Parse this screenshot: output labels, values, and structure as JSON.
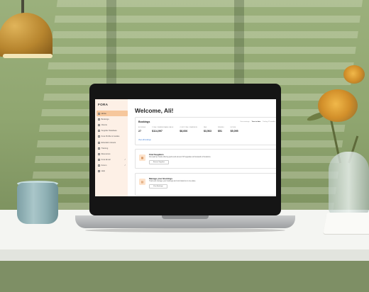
{
  "app": {
    "logo": "FORA"
  },
  "sidebar": {
    "items": [
      {
        "label": "Home",
        "icon": "home-icon",
        "active": true
      },
      {
        "label": "Bookings",
        "icon": "calendar-icon"
      },
      {
        "label": "Clients",
        "icon": "users-icon"
      },
      {
        "label": "Supplier Database",
        "icon": "database-icon"
      },
      {
        "label": "Fora Profile & Guides",
        "icon": "profile-icon"
      },
      {
        "label": "Education Assets",
        "icon": "book-icon"
      },
      {
        "label": "Training",
        "icon": "training-icon"
      },
      {
        "label": "Resources",
        "icon": "resources-icon"
      },
      {
        "label": "Fora Email",
        "icon": "mail-icon",
        "external": true
      },
      {
        "label": "Forum",
        "icon": "forum-icon",
        "external": true
      },
      {
        "label": "Help",
        "icon": "help-icon"
      }
    ],
    "external_glyph": "↗"
  },
  "main": {
    "welcome": "Welcome, Ali!",
    "bookings": {
      "title": "Bookings",
      "periods": [
        "Year to date",
        "Trailing 12 months"
      ],
      "period_prefix": "Your earnings",
      "stats": [
        {
          "label": "BOOKINGS",
          "value": "27"
        },
        {
          "label": "TOTAL COMMISSIONABLE VALUE",
          "value": "$114,997"
        },
        {
          "label": "YOUR TOTAL COMMISSION",
          "value": "$8,606"
        },
        {
          "label": "PAID",
          "value": "$3,563"
        },
        {
          "label": "PENDING",
          "value": "$51"
        },
        {
          "label": "FUTURE",
          "value": "$5,095"
        }
      ],
      "link": "View all bookings"
    },
    "promo1": {
      "title": "Find Suppliers",
      "desc": "Find partner hotels offering perks and access VIP upgrades at thousands of locations.",
      "button": "Browse Suppliers"
    },
    "promo2": {
      "title": "Manage your Bookings",
      "desc": "Track and manage your bookings and commissions in one place.",
      "button": "View Bookings"
    }
  }
}
